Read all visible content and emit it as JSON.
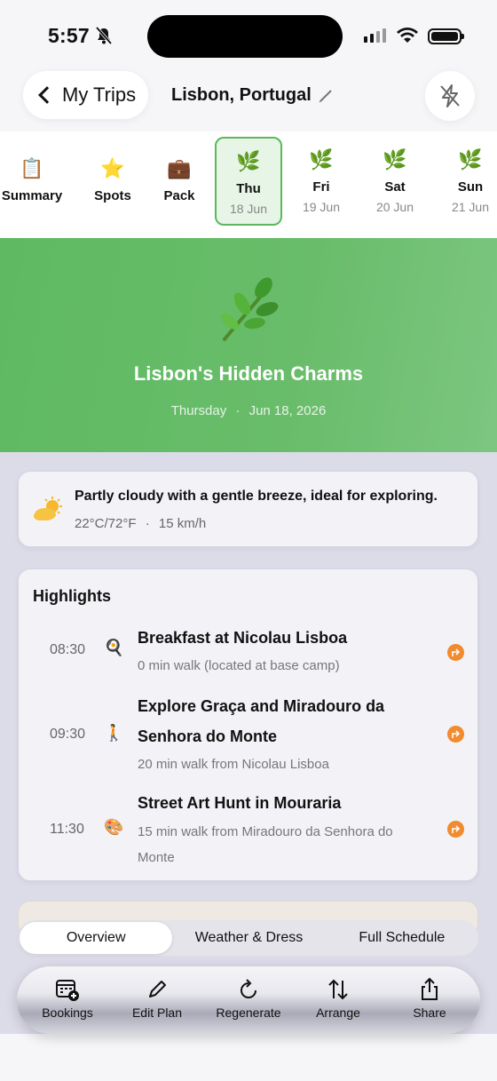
{
  "status_bar": {
    "time": "5:57"
  },
  "header": {
    "back_label": "My Trips",
    "trip_title": "Lisbon, Portugal"
  },
  "tabs": [
    {
      "label": "Summary",
      "icon": "clipboard-icon",
      "emoji": "📋"
    },
    {
      "label": "Spots",
      "icon": "star-icon",
      "emoji": "⭐"
    },
    {
      "label": "Pack",
      "icon": "luggage-icon",
      "emoji": "💼"
    },
    {
      "label": "Thu",
      "date": "18 Jun",
      "emoji": "🌿",
      "active": true
    },
    {
      "label": "Fri",
      "date": "19 Jun",
      "emoji": "🌿"
    },
    {
      "label": "Sat",
      "date": "20 Jun",
      "emoji": "🌿"
    },
    {
      "label": "Sun",
      "date": "21 Jun",
      "emoji": "🌿"
    }
  ],
  "hero": {
    "title": "Lisbon's Hidden Charms",
    "weekday": "Thursday",
    "separator": "·",
    "date": "Jun 18, 2026",
    "color": "#66bb6a"
  },
  "weather": {
    "summary": "Partly cloudy with a gentle breeze, ideal for exploring.",
    "temp": "22°C/72°F",
    "separator": "·",
    "wind": "15 km/h"
  },
  "highlights": {
    "title": "Highlights",
    "items": [
      {
        "time": "08:30",
        "emoji": "🍳",
        "name": "Breakfast at Nicolau Lisboa",
        "sub": "0 min walk (located at base camp)"
      },
      {
        "time": "09:30",
        "emoji": "🚶",
        "name": "Explore Graça and Miradouro da Senhora do Monte",
        "sub": "20 min walk from Nicolau Lisboa"
      },
      {
        "time": "11:30",
        "emoji": "🎨",
        "name": "Street Art Hunt in Mouraria",
        "sub": "15 min walk from Miradouro da Senhora do Monte"
      }
    ]
  },
  "segments": [
    "Overview",
    "Weather & Dress",
    "Full Schedule"
  ],
  "toolbar": [
    {
      "label": "Bookings",
      "icon": "calendar-add-icon"
    },
    {
      "label": "Edit Plan",
      "icon": "pencil-icon"
    },
    {
      "label": "Regenerate",
      "icon": "refresh-icon"
    },
    {
      "label": "Arrange",
      "icon": "arrange-icon"
    },
    {
      "label": "Share",
      "icon": "share-icon"
    }
  ],
  "colors": {
    "accent_green": "#5cb85c",
    "orange": "#f28a2e"
  }
}
